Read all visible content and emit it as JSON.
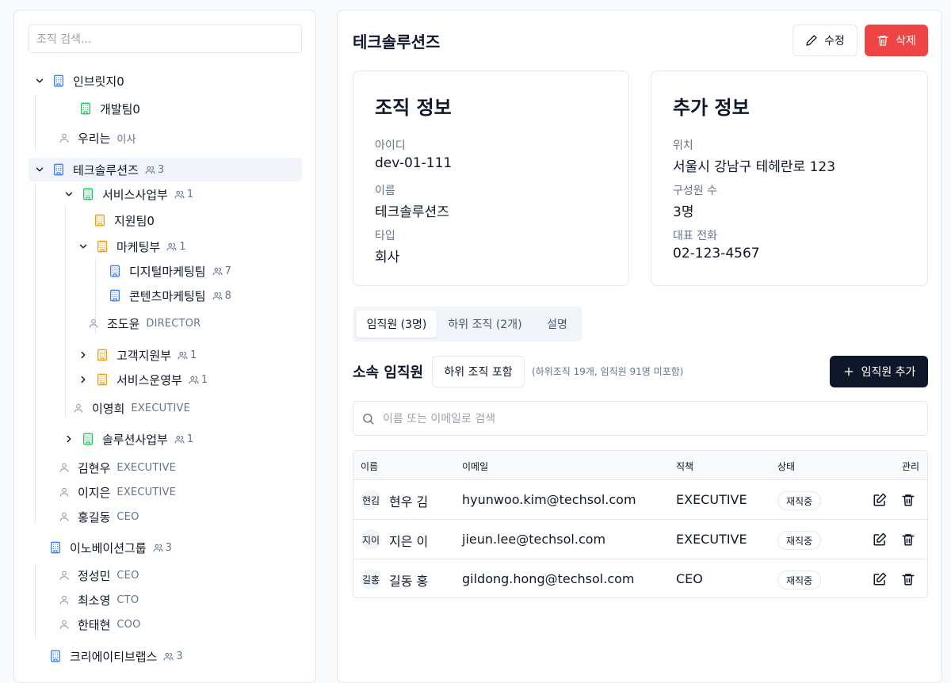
{
  "tree": {
    "search_placeholder": "조직 검색...",
    "nodes": [
      {
        "label": "인브릿지0"
      },
      {
        "label": "개발팀0"
      },
      {
        "label": "우리는",
        "role": "이사"
      },
      {
        "label": "테크솔루션즈",
        "count": "3"
      },
      {
        "label": "서비스사업부",
        "count": "1"
      },
      {
        "label": "지원팀0"
      },
      {
        "label": "마케팅부",
        "count": "1"
      },
      {
        "label": "디지털마케팅팀",
        "count": "7"
      },
      {
        "label": "콘텐츠마케팅팀",
        "count": "8"
      },
      {
        "label": "조도윤",
        "role": "DIRECTOR"
      },
      {
        "label": "고객지원부",
        "count": "1"
      },
      {
        "label": "서비스운영부",
        "count": "1"
      },
      {
        "label": "이영희",
        "role": "EXECUTIVE"
      },
      {
        "label": "솔루션사업부",
        "count": "1"
      },
      {
        "label": "김현우",
        "role": "EXECUTIVE"
      },
      {
        "label": "이지은",
        "role": "EXECUTIVE"
      },
      {
        "label": "홍길동",
        "role": "CEO"
      },
      {
        "label": "이노베이션그룹",
        "count": "3"
      },
      {
        "label": "정성민",
        "role": "CEO"
      },
      {
        "label": "최소영",
        "role": "CTO"
      },
      {
        "label": "한태현",
        "role": "COO"
      },
      {
        "label": "크리에이티브랩스",
        "count": "3"
      }
    ]
  },
  "detail": {
    "title": "테크솔루션즈",
    "edit_label": "수정",
    "delete_label": "삭제",
    "org_card": {
      "heading": "조직 정보",
      "fields": [
        {
          "label": "아이디",
          "value": "dev-01-111"
        },
        {
          "label": "이름",
          "value": "테크솔루션즈"
        },
        {
          "label": "타입",
          "value": "회사"
        }
      ]
    },
    "extra_card": {
      "heading": "추가 정보",
      "fields": [
        {
          "label": "위치",
          "value": "서울시 강남구 테헤란로 123"
        },
        {
          "label": "구성원 수",
          "value": "3명"
        },
        {
          "label": "대표 전화",
          "value": "02-123-4567"
        }
      ]
    },
    "tabs": [
      "임직원 (3명)",
      "하위 조직 (2개)",
      "설명"
    ],
    "section_title": "소속 임직원",
    "include_sub_label": "하위 조직 포함",
    "hint": "(하위조직 19개, 임직원 91명 미포함)",
    "add_label": "임직원 추가",
    "search_placeholder": "이름 또는 이메일로 검색",
    "table": {
      "headers": [
        "이름",
        "이메일",
        "직책",
        "상태",
        "관리"
      ],
      "rows": [
        {
          "avatar": "현김",
          "name": "현우 김",
          "email": "hyunwoo.kim@techsol.com",
          "title": "EXECUTIVE",
          "status": "재직중"
        },
        {
          "avatar": "지이",
          "name": "지은 이",
          "email": "jieun.lee@techsol.com",
          "title": "EXECUTIVE",
          "status": "재직중"
        },
        {
          "avatar": "길홍",
          "name": "길동 홍",
          "email": "gildong.hong@techsol.com",
          "title": "CEO",
          "status": "재직중"
        }
      ]
    }
  },
  "colors": {
    "blue": "#3b82f6",
    "green": "#22c55e",
    "orange": "#f59e0b",
    "danger": "#ef4444",
    "dark": "#0f172a"
  }
}
